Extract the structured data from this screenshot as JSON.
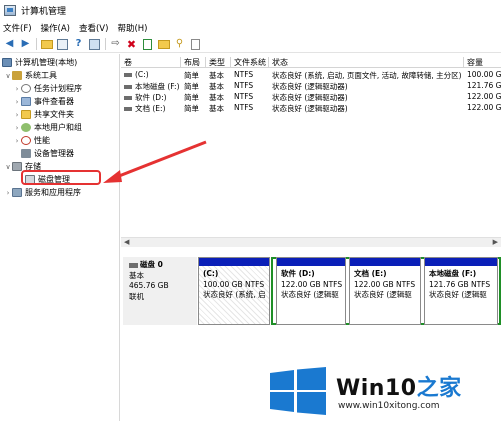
{
  "window": {
    "title": "计算机管理"
  },
  "menu": [
    "文件(F)",
    "操作(A)",
    "查看(V)",
    "帮助(H)"
  ],
  "toolbar_icons": [
    "back-arrow-icon",
    "forward-arrow-icon",
    "up-folder-icon",
    "properties-icon",
    "help-icon",
    "console-icon",
    "connect-icon",
    "delete-icon",
    "checklist-icon",
    "open-folder-icon",
    "search-icon",
    "document-icon"
  ],
  "tree": {
    "root": "计算机管理(本地)",
    "system_tools": "系统工具",
    "task_scheduler": "任务计划程序",
    "event_viewer": "事件查看器",
    "shared_folders": "共享文件夹",
    "local_users": "本地用户和组",
    "performance": "性能",
    "device_manager": "设备管理器",
    "storage": "存储",
    "disk_management": "磁盘管理",
    "services": "服务和应用程序"
  },
  "volumes": {
    "headers": [
      "卷",
      "布局",
      "类型",
      "文件系统",
      "状态",
      "容量"
    ],
    "rows": [
      [
        "(C:)",
        "简单",
        "基本",
        "NTFS",
        "状态良好 (系统, 启动, 页面文件, 活动, 故障转储, 主分区)",
        "100.00 G"
      ],
      [
        "本地磁盘 (F:)",
        "简单",
        "基本",
        "NTFS",
        "状态良好 (逻辑驱动器)",
        "121.76 G"
      ],
      [
        "软件 (D:)",
        "简单",
        "基本",
        "NTFS",
        "状态良好 (逻辑驱动器)",
        "122.00 G"
      ],
      [
        "文档 (E:)",
        "简单",
        "基本",
        "NTFS",
        "状态良好 (逻辑驱动器)",
        "122.00 G"
      ]
    ]
  },
  "disk0": {
    "name": "磁盘 0",
    "type": "基本",
    "size": "465.76 GB",
    "status": "联机"
  },
  "partitions": [
    {
      "name": "(C:)",
      "size": "100.00 GB NTFS",
      "status": "状态良好 (系统, 启"
    },
    {
      "name": "软件  (D:)",
      "size": "122.00 GB NTFS",
      "status": "状态良好 (逻辑驱"
    },
    {
      "name": "文档  (E:)",
      "size": "122.00 GB NTFS",
      "status": "状态良好 (逻辑驱"
    },
    {
      "name": "本地磁盘  (F:)",
      "size": "121.76 GB NTFS",
      "status": "状态良好 (逻辑驱"
    }
  ],
  "watermark": {
    "brand": "Win10",
    "brand_suffix": "之家",
    "url": "www.win10xitong.com"
  },
  "colors": {
    "callout": "#e53232",
    "partition_bar": "#0a1fb8",
    "extended_frame": "#1f8f27",
    "logo_blue": "#1a79d0"
  }
}
